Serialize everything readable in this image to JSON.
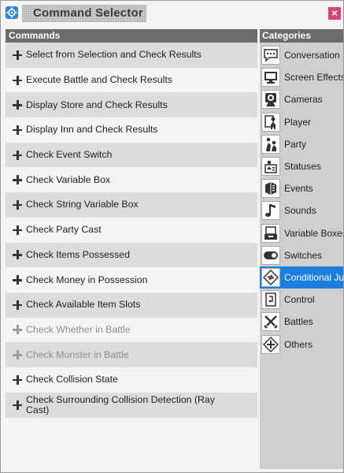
{
  "window": {
    "title": "Command Selector",
    "close_glyph": "×",
    "accent_color": "#1a7de0",
    "close_color": "#d6457a"
  },
  "commands": {
    "header": "Commands",
    "items": [
      {
        "label": "Select from Selection and Check Results",
        "enabled": true
      },
      {
        "label": "Execute Battle and Check Results",
        "enabled": true
      },
      {
        "label": "Display Store and Check Results",
        "enabled": true
      },
      {
        "label": "Display Inn and Check Results",
        "enabled": true
      },
      {
        "label": "Check Event Switch",
        "enabled": true
      },
      {
        "label": "Check Variable Box",
        "enabled": true
      },
      {
        "label": "Check String Variable Box",
        "enabled": true
      },
      {
        "label": "Check Party Cast",
        "enabled": true
      },
      {
        "label": "Check Items Possessed",
        "enabled": true
      },
      {
        "label": "Check Money in Possession",
        "enabled": true
      },
      {
        "label": "Check Available Item Slots",
        "enabled": true
      },
      {
        "label": "Check Whether in Battle",
        "enabled": false
      },
      {
        "label": "Check Monster in Battle",
        "enabled": false
      },
      {
        "label": "Check Collision State",
        "enabled": true
      },
      {
        "label": "Check Surrounding Collision Detection (Ray Cast)",
        "enabled": true
      }
    ]
  },
  "categories": {
    "header": "Categories",
    "items": [
      {
        "label": "Conversation",
        "icon": "speech-bubble-icon"
      },
      {
        "label": "Screen Effects",
        "icon": "monitor-icon"
      },
      {
        "label": "Cameras",
        "icon": "camera-icon"
      },
      {
        "label": "Player",
        "icon": "player-icon"
      },
      {
        "label": "Party",
        "icon": "party-icon"
      },
      {
        "label": "Statuses",
        "icon": "status-icon"
      },
      {
        "label": "Events",
        "icon": "events-icon"
      },
      {
        "label": "Sounds",
        "icon": "music-note-icon"
      },
      {
        "label": "Variable Boxes",
        "icon": "variable-box-icon"
      },
      {
        "label": "Switches",
        "icon": "toggle-switch-icon"
      },
      {
        "label": "Conditional Jumps",
        "icon": "conditional-jump-icon",
        "selected": true
      },
      {
        "label": "Control",
        "icon": "control-flow-icon"
      },
      {
        "label": "Battles",
        "icon": "crossed-swords-icon"
      },
      {
        "label": "Others",
        "icon": "others-icon"
      }
    ]
  }
}
